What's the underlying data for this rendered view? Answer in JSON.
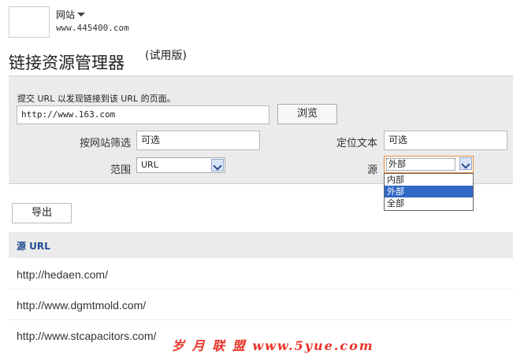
{
  "site": {
    "name": "网站",
    "url": "www.445400.com"
  },
  "page": {
    "title": "链接资源管理器",
    "title_suffix": "(试用版)"
  },
  "form": {
    "instruction": "提交 URL 以发现链接到该 URL 的页面。",
    "url_value": "http://www.163.com",
    "browse_label": "浏览",
    "filter_site_label": "按网站筛选",
    "filter_site_value": "可选",
    "anchor_text_label": "定位文本",
    "anchor_text_value": "可选",
    "scope_label": "范围",
    "scope_value": "URL",
    "source_label": "源",
    "source_value": "外部",
    "source_options": [
      "内部",
      "外部",
      "全部"
    ],
    "source_selected_index": 1
  },
  "export_label": "导出",
  "results": {
    "column_header": "源 URL",
    "rows": [
      "http://hedaen.com/",
      "http://www.dgmtmold.com/",
      "http://www.stcapacitors.com/"
    ]
  },
  "watermark": "岁 月 联 盟  www.5yue.com",
  "colors": {
    "panel_bg": "#ebebeb",
    "header_link": "#1f4d91",
    "selected_option": "#3169c6",
    "watermark": "#e8342a"
  }
}
